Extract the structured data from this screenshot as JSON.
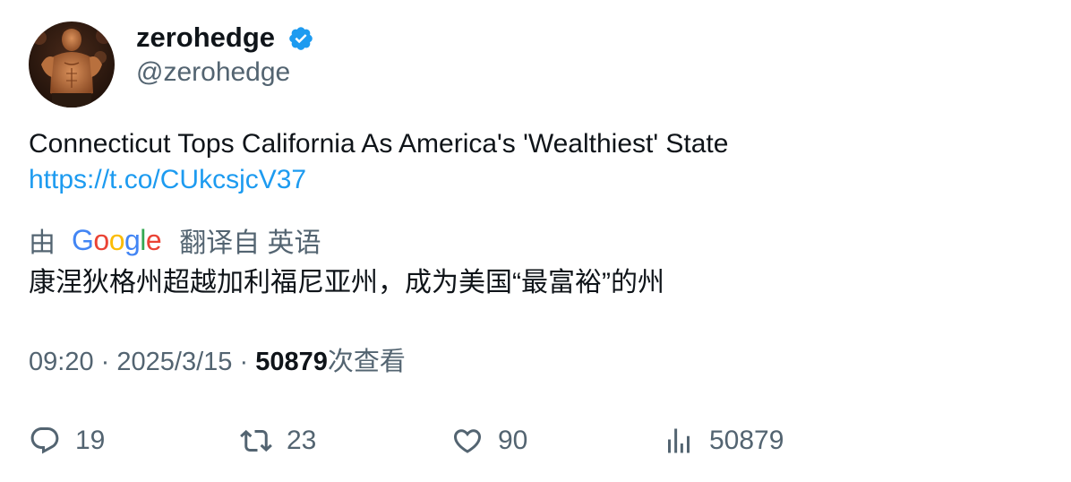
{
  "author": {
    "display_name": "zerohedge",
    "handle": "@zerohedge",
    "verified": true,
    "verified_color": "#1d9bf0"
  },
  "tweet": {
    "text": "Connecticut Tops California As America's 'Wealthiest' State",
    "link": "https://t.co/CUkcsjcV37"
  },
  "translation": {
    "by_label": "由",
    "provider_letters": [
      "G",
      "o",
      "o",
      "g",
      "l",
      "e"
    ],
    "provider_colors": [
      "#4285f4",
      "#ea4335",
      "#fbbc05",
      "#4285f4",
      "#34a853",
      "#ea4335"
    ],
    "translated_from_label": "翻译自 英语",
    "translated_text": "康涅狄格州超越加利福尼亚州，成为美国“最富裕”的州"
  },
  "meta": {
    "time": "09:20",
    "separator": "·",
    "date": "2025/3/15",
    "views_count": "50879",
    "views_label": "次查看"
  },
  "actions": {
    "replies": "19",
    "retweets": "23",
    "likes": "90",
    "views": "50879"
  },
  "icons": {
    "reply": "speech-bubble-icon",
    "retweet": "retweet-arrows-icon",
    "like": "heart-icon",
    "views": "bar-chart-icon",
    "verified": "verified-badge-icon"
  },
  "colors": {
    "text_primary": "#0f1419",
    "text_secondary": "#536471",
    "link": "#1d9bf0"
  }
}
